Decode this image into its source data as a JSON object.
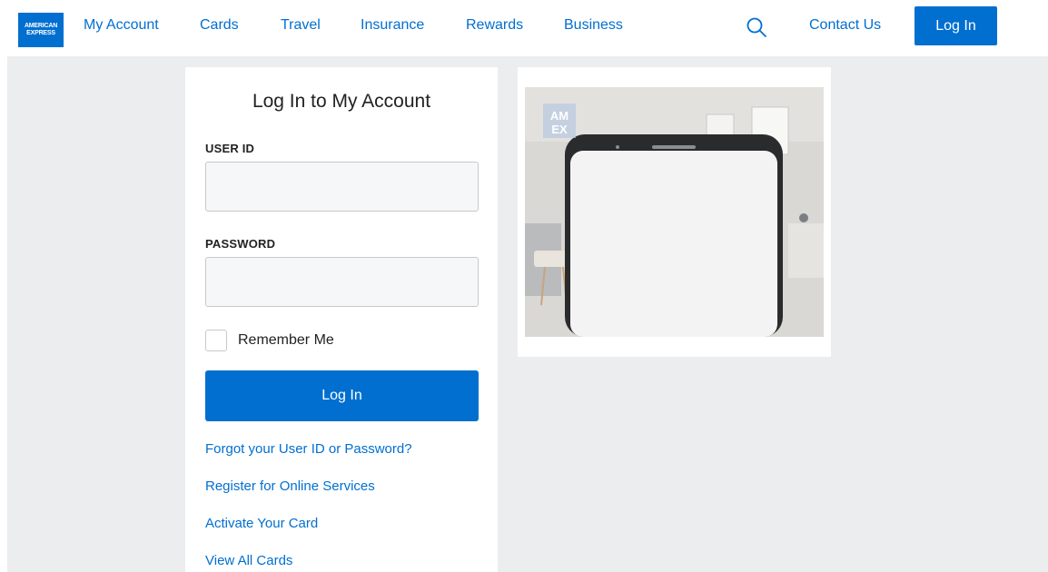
{
  "header": {
    "logo": {
      "line1": "AMERICAN",
      "line2": "EXPRESS"
    },
    "nav": [
      "My Account",
      "Cards",
      "Travel",
      "Insurance",
      "Rewards",
      "Business"
    ],
    "contact_label": "Contact Us",
    "login_label": "Log In",
    "search_icon": "search-icon"
  },
  "login": {
    "title": "Log In to My Account",
    "user_id_label": "USER ID",
    "user_id_value": "",
    "password_label": "PASSWORD",
    "password_value": "",
    "remember_label": "Remember Me",
    "remember_checked": false,
    "submit_label": "Log In",
    "links": [
      "Forgot your User ID or Password?",
      "Register for Online Services",
      "Activate Your Card",
      "View All Cards"
    ]
  },
  "promo": {
    "image_icon": "phone-image",
    "watermark_line1": "AM",
    "watermark_line2": "EX"
  },
  "colors": {
    "brand": "#016fd0",
    "page_bg": "#ecedee",
    "field_bg": "#f6f7f8"
  }
}
